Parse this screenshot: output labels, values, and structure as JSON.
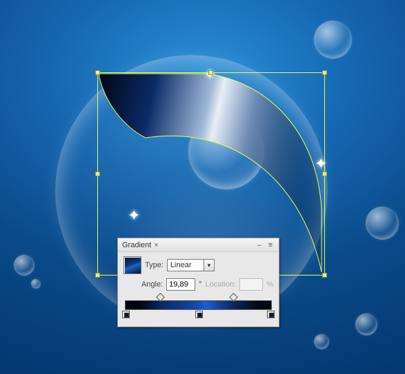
{
  "panel": {
    "title": "Gradient",
    "close_glyph": "×",
    "minimize_glyph": "–",
    "menu_glyph": "≡",
    "type_label": "Type:",
    "type_value": "Linear",
    "angle_label": "Angle:",
    "angle_value": "19,89",
    "degree_glyph": "°",
    "location_label": "Location:",
    "location_value": "",
    "percent_glyph": "%"
  },
  "swatch_gradient": {
    "angle_deg": 19.89,
    "type": "Linear"
  },
  "gradient_ramp": {
    "opacity_stops_pct": [
      22,
      72
    ],
    "color_stops_pct": [
      0,
      50,
      100
    ]
  },
  "selection": {
    "handles": 8,
    "stroke": "#e6ff4d"
  },
  "colors": {
    "canvas_bg": "#0a4a8a",
    "panel_bg": "#e8e8e8",
    "sel_stroke": "#e6ff4d"
  }
}
